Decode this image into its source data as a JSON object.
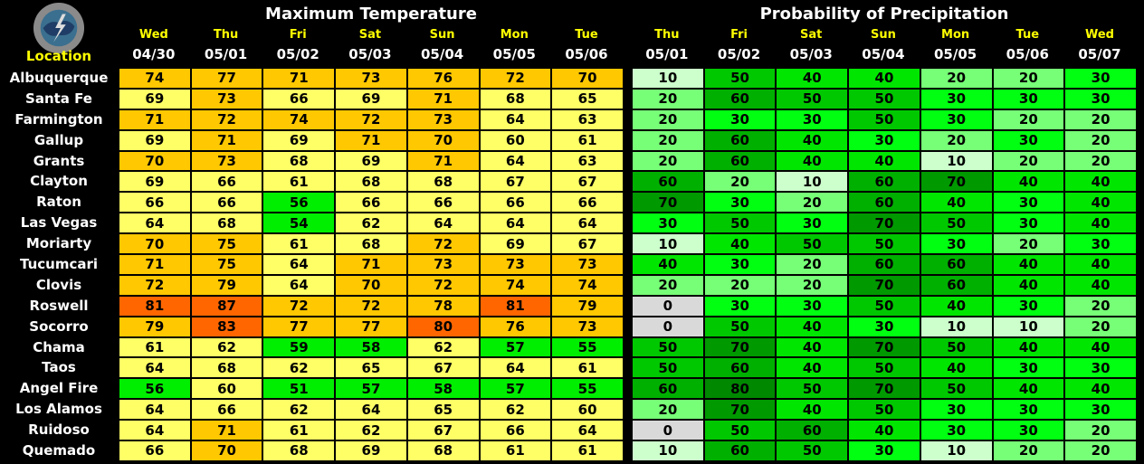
{
  "logo": {
    "label": "National Weather Service"
  },
  "location_header": "Location",
  "locations": [
    "Albuquerque",
    "Santa Fe",
    "Farmington",
    "Gallup",
    "Grants",
    "Clayton",
    "Raton",
    "Las Vegas",
    "Moriarty",
    "Tucumcari",
    "Clovis",
    "Roswell",
    "Socorro",
    "Chama",
    "Taos",
    "Angel Fire",
    "Los Alamos",
    "Ruidoso",
    "Quemado"
  ],
  "temp_colors": {
    "80plus": "#ff6600",
    "70s": "#ffc800",
    "60s": "#ffff66",
    "50s": "#00ee00"
  },
  "pop_colors": {
    "0": "#d9d9d9",
    "10": "#ccffcc",
    "20": "#77ff77",
    "30": "#00ff11",
    "40": "#00e600",
    "50": "#00c800",
    "60": "#00b000",
    "70": "#009900",
    "80": "#008800"
  },
  "chart_data": [
    {
      "type": "table",
      "title": "Maximum Temperature",
      "days": [
        "Wed",
        "Thu",
        "Fri",
        "Sat",
        "Sun",
        "Mon",
        "Tue"
      ],
      "dates": [
        "04/30",
        "05/01",
        "05/02",
        "05/03",
        "05/04",
        "05/05",
        "05/06"
      ],
      "rows": [
        [
          74,
          77,
          71,
          73,
          76,
          72,
          70
        ],
        [
          69,
          73,
          66,
          69,
          71,
          68,
          65
        ],
        [
          71,
          72,
          74,
          72,
          73,
          64,
          63
        ],
        [
          69,
          71,
          69,
          71,
          70,
          60,
          61
        ],
        [
          70,
          73,
          68,
          69,
          71,
          64,
          63
        ],
        [
          69,
          66,
          61,
          68,
          68,
          67,
          67
        ],
        [
          66,
          66,
          56,
          66,
          66,
          66,
          66
        ],
        [
          64,
          68,
          54,
          62,
          64,
          64,
          64
        ],
        [
          70,
          75,
          61,
          68,
          72,
          69,
          67
        ],
        [
          71,
          75,
          64,
          71,
          73,
          73,
          73
        ],
        [
          72,
          79,
          64,
          70,
          72,
          74,
          74
        ],
        [
          81,
          87,
          72,
          72,
          78,
          81,
          79
        ],
        [
          79,
          83,
          77,
          77,
          80,
          76,
          73
        ],
        [
          61,
          62,
          59,
          58,
          62,
          57,
          55
        ],
        [
          64,
          68,
          62,
          65,
          67,
          64,
          61
        ],
        [
          56,
          60,
          51,
          57,
          58,
          57,
          55
        ],
        [
          64,
          66,
          62,
          64,
          65,
          62,
          60
        ],
        [
          64,
          71,
          61,
          62,
          67,
          66,
          64
        ],
        [
          66,
          70,
          68,
          69,
          68,
          61,
          61
        ]
      ]
    },
    {
      "type": "table",
      "title": "Probability of Precipitation",
      "days": [
        "Thu",
        "Fri",
        "Sat",
        "Sun",
        "Mon",
        "Tue",
        "Wed"
      ],
      "dates": [
        "05/01",
        "05/02",
        "05/03",
        "05/04",
        "05/05",
        "05/06",
        "05/07"
      ],
      "rows": [
        [
          10,
          50,
          40,
          40,
          20,
          20,
          30
        ],
        [
          20,
          60,
          50,
          50,
          30,
          30,
          30
        ],
        [
          20,
          30,
          30,
          50,
          30,
          20,
          20
        ],
        [
          20,
          60,
          40,
          30,
          20,
          30,
          20
        ],
        [
          20,
          60,
          40,
          40,
          10,
          20,
          20
        ],
        [
          60,
          20,
          10,
          60,
          70,
          40,
          40
        ],
        [
          70,
          30,
          20,
          60,
          40,
          30,
          40
        ],
        [
          30,
          50,
          30,
          70,
          50,
          30,
          40
        ],
        [
          10,
          40,
          50,
          50,
          30,
          20,
          30
        ],
        [
          40,
          30,
          20,
          60,
          60,
          40,
          40
        ],
        [
          20,
          20,
          20,
          70,
          60,
          40,
          40
        ],
        [
          0,
          30,
          30,
          50,
          40,
          30,
          20
        ],
        [
          0,
          50,
          40,
          30,
          10,
          10,
          20
        ],
        [
          50,
          70,
          40,
          70,
          50,
          40,
          40
        ],
        [
          50,
          60,
          40,
          50,
          40,
          30,
          30
        ],
        [
          60,
          80,
          50,
          70,
          50,
          40,
          40
        ],
        [
          20,
          70,
          40,
          50,
          30,
          30,
          30
        ],
        [
          0,
          50,
          60,
          40,
          30,
          30,
          20
        ],
        [
          10,
          60,
          50,
          30,
          10,
          20,
          20
        ]
      ]
    }
  ]
}
